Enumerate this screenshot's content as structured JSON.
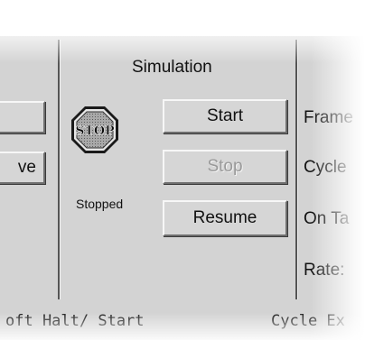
{
  "left_panel": {
    "button_top_label": "",
    "button_bottom_label": "ve"
  },
  "simulation": {
    "title": "Simulation",
    "stop_sign_text": "STOP",
    "status": "Stopped",
    "buttons": {
      "start": "Start",
      "stop": "Stop",
      "resume": "Resume"
    }
  },
  "right_labels": {
    "frame": "Frame",
    "cycle": "Cycle",
    "on_ta": "On Ta",
    "rate": "Rate:"
  },
  "footer": {
    "left": "oft Halt/ Start",
    "right": "Cycle Ex"
  },
  "colors": {
    "panel": "#d3d3d3",
    "stop_sign_fill": "#8c8c8c"
  },
  "icons": {
    "stop_sign": "stop-sign-icon"
  }
}
